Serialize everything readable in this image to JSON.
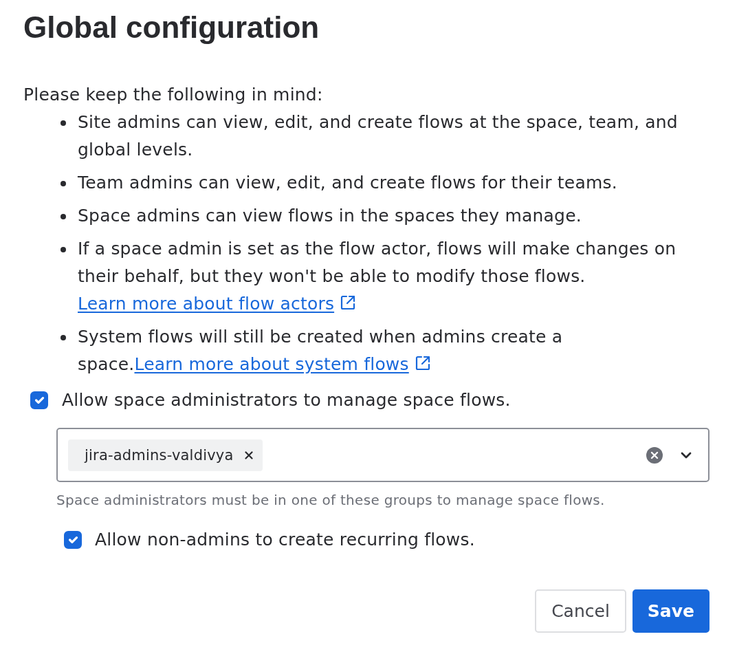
{
  "title": "Global configuration",
  "intro": "Please keep the following in mind:",
  "notes": [
    {
      "text": "Site admins can view, edit, and create flows at the space, team, and global levels."
    },
    {
      "text": "Team admins can view, edit, and create flows for their teams."
    },
    {
      "text": "Space admins can view flows in the spaces they manage."
    },
    {
      "text": "If a space admin is set as the flow actor, flows will make changes on their behalf, but they won't be able to modify those flows. ",
      "link": "Learn more about flow actors"
    },
    {
      "text": "System flows will still be created when admins create a space.",
      "link": "Learn more about system flows"
    }
  ],
  "space_admin_option": {
    "label": "Allow space administrators to manage space flows.",
    "checked": true
  },
  "groups_field": {
    "tags": [
      {
        "label": "jira-admins-valdivya"
      }
    ],
    "helper": "Space administrators must be in one of these groups to manage space flows."
  },
  "recurring_option": {
    "label": "Allow non-admins to create recurring flows.",
    "checked": true
  },
  "buttons": [
    {
      "label": "Cancel",
      "kind": "secondary"
    },
    {
      "label": "Save",
      "kind": "primary"
    }
  ]
}
